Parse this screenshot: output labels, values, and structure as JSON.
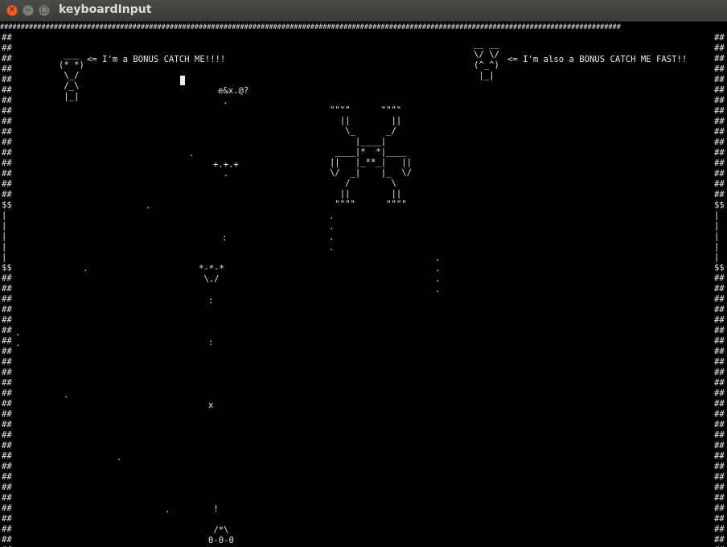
{
  "window": {
    "title": "keyboardInput",
    "close_glyph": "✕",
    "minimize_glyph": "−",
    "maximize_glyph": "□"
  },
  "colors": {
    "background": "#000000",
    "foreground": "#e8e8e8",
    "titlebar": "#3c3b37",
    "close_button": "#e8602d"
  },
  "game": {
    "top_border": "######################################################################################################################################################",
    "left_wall": "##\n##\n##\n##\n##\n##\n##\n##\n##\n##\n##\n##\n##\n##\n##\n##\n$$\n|\n|\n|\n|\n|\n$$\n##\n##\n##\n##\n##\n##\n##\n##\n##\n##\n##\n##\n##\n##\n##\n##\n##\n##\n##\n##\n##\n##\n##\n##\n##\n##\n##",
    "right_wall": "##\n##\n##\n##\n##\n##\n##\n##\n##\n##\n##\n##\n##\n##\n##\n##\n$$\n|\n|\n|\n|\n|\n$$\n##\n##\n##\n##\n##\n##\n##\n##\n##\n##\n##\n##\n##\n##\n##\n##\n##\n##\n##\n##\n##\n##\n##\n##\n##\n##\n##",
    "bonus_left_art": " ___\n(* *)\n \\_/\n /_\\\n |_|",
    "bonus_left_text": "<= I'm a BONUS CATCH ME!!!!",
    "bonus_right_art": "__ __\n\\/ \\/\n(^_^)\n |_|",
    "bonus_right_text": "<= I'm also a BONUS CATCH ME FAST!!",
    "boss_art": "\"\"\"\"      \"\"\"\"\n  ||        ||\n   \\_      _/\n     |____|\n ____|*  *|____\n||   |_**_|   ||\n\\/  _|    |_  \\/\n   /        \\\n  ||        ||\n \"\"\"\"      \"\"\"\"",
    "mob_top": "e&x.@?",
    "mob_mid": "+.+.+\n  -",
    "mob_low": "*-*-*\n \\./",
    "player_art": " !\n\n /*\\\n0-0-0",
    "x_mark": "x",
    "dot": ".",
    "colon": ":",
    "vdots": ".\n.\n.\n.",
    "wall_dots": ".\n."
  }
}
